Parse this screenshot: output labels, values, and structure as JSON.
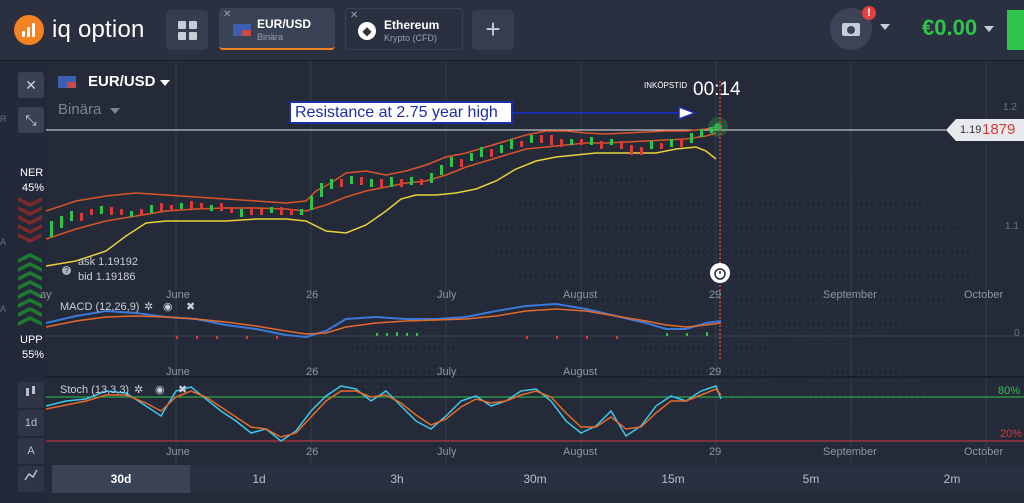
{
  "header": {
    "logo_text": "iq option",
    "tabs": [
      {
        "title": "EUR/USD",
        "subtitle": "Binära",
        "active": true
      },
      {
        "title": "Ethereum",
        "subtitle": "Krypto (CFD)",
        "active": false
      }
    ],
    "add_tab_label": "+",
    "camera_alert": "!",
    "balance": "€0.00"
  },
  "sidebar": {
    "close_label": "✕",
    "collapse_label": "⤡",
    "ner_label": "NER",
    "ner_pct": "45%",
    "upp_label": "UPP",
    "upp_pct": "55%",
    "tool_1d": "1d",
    "tool_a": "A",
    "left_ticks": [
      "R",
      "A",
      "A",
      "A"
    ]
  },
  "chart_header": {
    "asset": "EUR/USD",
    "mode": "Binära",
    "expiry_label": "INKÖPSTID",
    "timer": "00:14",
    "annotation": "Resistance at 2.75 year high",
    "price_small": "1.19",
    "price_big": "1879",
    "ask": "ask 1.19192",
    "bid": "bid 1.19186",
    "help": "?"
  },
  "axes": {
    "months_main": [
      "June",
      "26",
      "July",
      "August",
      "29",
      "September",
      "October"
    ],
    "months_macd": [
      "June",
      "26",
      "July",
      "August",
      "29"
    ],
    "months_stoch": [
      "June",
      "26",
      "July",
      "August",
      "29",
      "September",
      "October"
    ],
    "price_ticks": [
      "1.2",
      "1.1"
    ],
    "macd_zero": "0",
    "stoch_upper": "80%",
    "stoch_lower": "20%",
    "partial_may": "ay"
  },
  "indicators": {
    "macd": "MACD (12,26,9)",
    "stoch": "Stoch (13,3,3)"
  },
  "timeframes": [
    {
      "label": "30d",
      "active": true
    },
    {
      "label": "1d",
      "active": false
    },
    {
      "label": "3h",
      "active": false
    },
    {
      "label": "30m",
      "active": false
    },
    {
      "label": "15m",
      "active": false
    },
    {
      "label": "5m",
      "active": false
    },
    {
      "label": "2m",
      "active": false
    }
  ],
  "colors": {
    "accent": "#f58220",
    "green": "#2fc44c",
    "red": "#d93a3a",
    "bollinger_outer": "#d9542a",
    "bollinger_lower": "#e8d13a",
    "macd_line": "#3c78d8",
    "signal_line": "#e46a2a",
    "stoch_k": "#3cc8e8",
    "stoch_d": "#e46a2a",
    "annotation": "#1d2fa8"
  },
  "chart_data": {
    "type": "line",
    "x": [
      "May",
      "June",
      "26",
      "July",
      "August",
      "29"
    ],
    "series": [],
    "price_close": [
      1.108,
      1.125,
      1.121,
      1.118,
      1.14,
      1.16,
      1.172,
      1.175,
      1.17,
      1.18,
      1.1879
    ],
    "macd": [
      0.002,
      0.003,
      0.001,
      -0.002,
      0.001,
      0.004,
      0.006,
      0.007,
      0.004,
      0.002,
      0.004
    ],
    "signal": [
      0.001,
      0.002,
      0.002,
      0.0,
      0.0,
      0.003,
      0.005,
      0.006,
      0.005,
      0.003,
      0.003
    ],
    "stoch_k": [
      55,
      78,
      40,
      20,
      65,
      85,
      72,
      45,
      30,
      70,
      82,
      70
    ],
    "stoch_d": [
      50,
      70,
      48,
      25,
      55,
      80,
      74,
      52,
      35,
      62,
      78,
      74
    ],
    "levels": {
      "stoch_upper": 80,
      "stoch_lower": 20
    },
    "ylabel": ""
  }
}
